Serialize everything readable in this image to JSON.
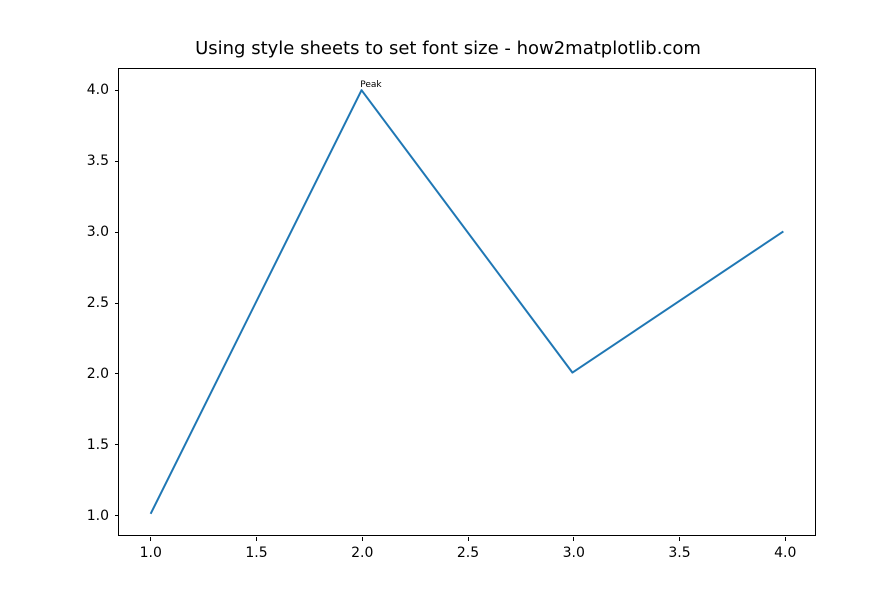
{
  "chart_data": {
    "type": "line",
    "title": "Using style sheets to set font size - how2matplotlib.com",
    "x": [
      1,
      2,
      3,
      4
    ],
    "y": [
      1,
      4,
      2,
      3
    ],
    "xlabel": "",
    "ylabel": "",
    "xlim": [
      0.85,
      4.15
    ],
    "ylim": [
      0.85,
      4.15
    ],
    "xticks": [
      "1.0",
      "1.5",
      "2.0",
      "2.5",
      "3.0",
      "3.5",
      "4.0"
    ],
    "yticks": [
      "1.0",
      "1.5",
      "2.0",
      "2.5",
      "3.0",
      "3.5",
      "4.0"
    ],
    "annotations": [
      {
        "text": "Peak",
        "x": 2,
        "y": 4
      }
    ],
    "line_color": "#1f77b4"
  }
}
